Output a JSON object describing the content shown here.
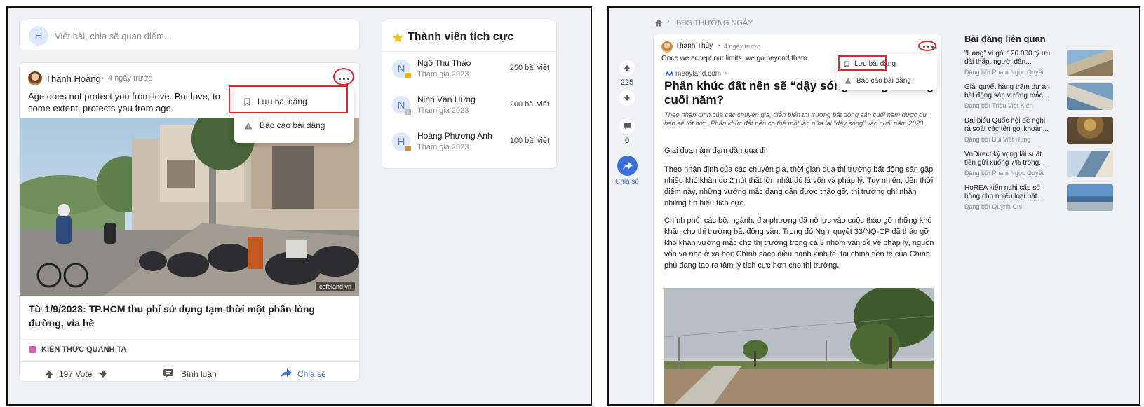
{
  "left": {
    "composer": {
      "avatar_letter": "H",
      "placeholder": "Viết bài, chia sẽ quan điểm..."
    },
    "post": {
      "author": "Thành Hoàng",
      "time": "4 ngày trước",
      "text": "Age does not protect you from love. But love, to some extent, protects you from age.",
      "image_source": "cafeland.vn",
      "headline": "Từ 1/9/2023: TP.HCM thu phí sử dụng tạm thời một phần lòng đường, vỉa hè",
      "category": "KIẾN THỨC QUANH TA",
      "category_color": "#d35db0",
      "votes": "197 Vote",
      "comment_label": "Bình luận",
      "share_label": "Chia sẻ"
    },
    "menu": {
      "save": "Lưu bài đăng",
      "report": "Báo cáo bài đăng"
    },
    "members": {
      "title": "Thành viên tích cực",
      "items": [
        {
          "letter": "N",
          "name": "Ngô Thu Thảo",
          "joined": "Tham gia 2023",
          "posts": "250 bài viết",
          "badge": "#f2b705"
        },
        {
          "letter": "N",
          "name": "Ninh Văn Hưng",
          "joined": "Tham gia 2023",
          "posts": "200 bài viết",
          "badge": "#b8bcc4"
        },
        {
          "letter": "H",
          "name": "Hoàng Phương Anh",
          "joined": "Tham gia 2023",
          "posts": "100 bài viết",
          "badge": "#c9934a"
        }
      ]
    }
  },
  "right": {
    "breadcrumb": "BĐS THƯỜNG NGÀY",
    "votes": "225",
    "comments": "0",
    "share_label": "Chia sẻ",
    "post": {
      "author": "Thanh Thủy",
      "time": "4 ngày trước",
      "quote": "Once we accept our limits, we go beyond them.",
      "source": "meeyland.com",
      "title": "Phân khúc đất nền sẽ “dậy sóng” trong 6 tháng cuối năm?",
      "lead": "Theo nhận định của các chuyên gia, diễn biến thị trường bất động sản cuối năm được dự báo sẽ tốt hơn. Phân khúc đất nền có thể một lần nữa lại “dậy sóng” vào cuối năm 2023.",
      "heading": "Giai đoạn ảm đạm dần qua đi",
      "para1": "Theo nhận định của các chuyên gia, thời gian qua thị trường bất động sản gặp nhiều khó khăn do 2 nút thắt lớn nhất đó là vốn và pháp lý. Tuy nhiên, đến thời điểm này, những vướng mắc đang dần được tháo gỡ, thị trường ghi nhận những tín hiệu tích cực.",
      "para2": "Chính phủ, các bộ, ngành, địa phương đã nỗ lực vào cuộc tháo gỡ những khó khăn cho thị trường bất động sản. Trong đó Nghị quyết 33/NQ-CP đã tháo gỡ khó khăn vướng mắc cho thị trường trong cả 3 nhóm vấn đề về pháp lý, nguồn vốn và nhà ở xã hội; Chính sách điều hành kinh tế, tài chính tiền tệ của Chính phủ đang tạo ra tâm lý tích cực hơn cho thị trường."
    },
    "menu": {
      "save": "Lưu bài đăng",
      "report": "Báo cáo bài đăng"
    },
    "related": {
      "title": "Bài đăng liên quan",
      "items": [
        {
          "title": "\"Hàng\" vì gói 120.000 tỷ ưu đãi thấp, người dân...",
          "by": "Đăng bởi Phạm Ngọc Quyết"
        },
        {
          "title": "Giải quyết hàng trăm dự án bất động sản vướng mắc...",
          "by": "Đăng bởi Triệu Việt Kiên"
        },
        {
          "title": "Đại biểu Quốc hội đề nghị rà soát các tên gọi khoản...",
          "by": "Đăng bởi Bùi Việt Hùng"
        },
        {
          "title": "VnDirect kỳ vọng lãi suất tiền gửi xuống 7% trong...",
          "by": "Đăng bởi Phạm Ngọc Quyết"
        },
        {
          "title": "HoREA kiến nghị cấp sổ hồng cho nhiều loại bất...",
          "by": "Đăng bởi Quỳnh Chi"
        }
      ]
    }
  }
}
